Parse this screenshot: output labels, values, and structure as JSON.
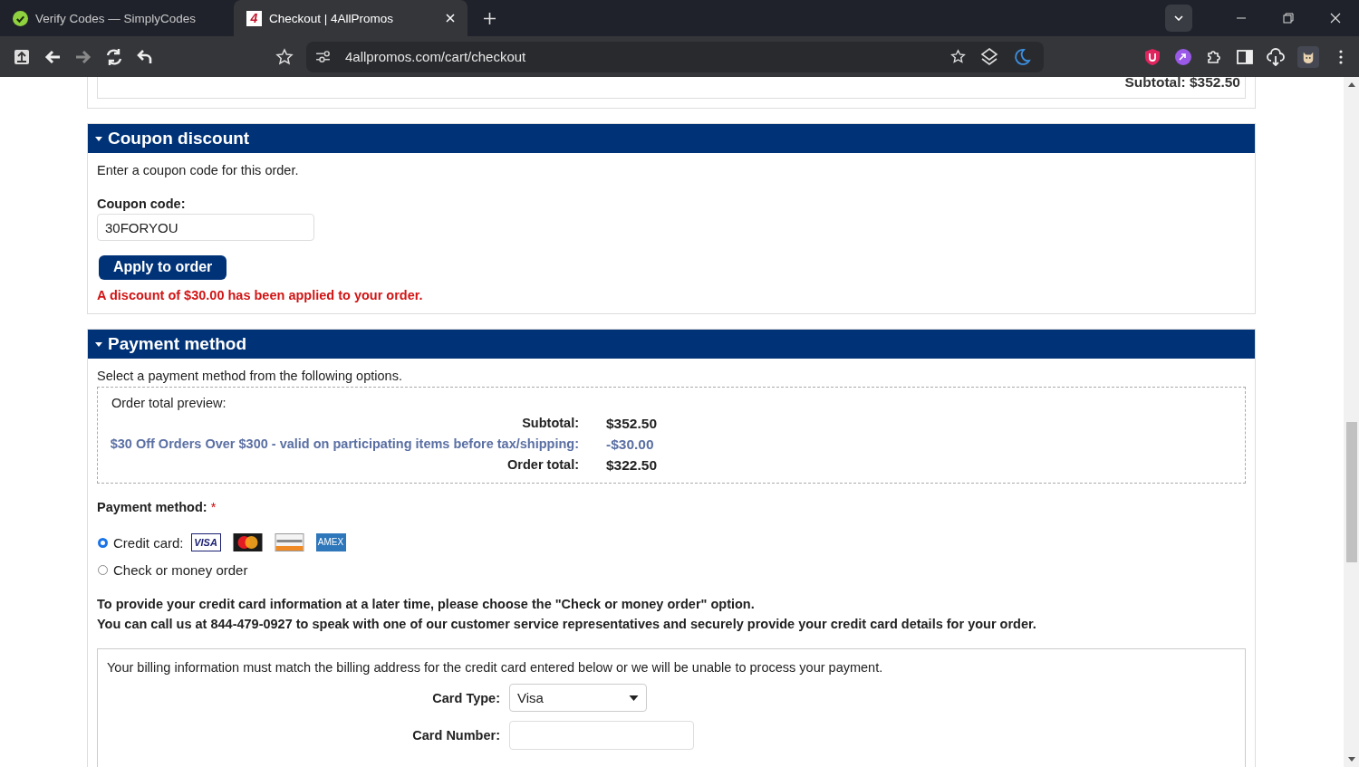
{
  "browser": {
    "tabs": [
      {
        "title": "Verify Codes — SimplyCodes",
        "selected": false
      },
      {
        "title": "Checkout | 4AllPromos",
        "selected": true,
        "logo": "4"
      }
    ],
    "url": "4allpromos.com/cart/checkout"
  },
  "cart": {
    "subtotal": "Subtotal: $352.50"
  },
  "coupon": {
    "title": "Coupon discount",
    "expanded": true,
    "intro": "Enter a coupon code for this order.",
    "label": "Coupon code:",
    "value": "30FORYOU",
    "button": "Apply to order",
    "message": "A discount of $30.00 has been applied to your order."
  },
  "payment": {
    "title": "Payment method",
    "expanded": true,
    "intro": "Select a payment method from the following options.",
    "preview": {
      "title": "Order total preview:",
      "lines": [
        {
          "kind": "total",
          "label": "Subtotal:",
          "amount": "$352.50"
        },
        {
          "kind": "discount",
          "label": "$30 Off Orders Over $300 - valid on participating items before tax/shipping:",
          "amount": "-$30.00"
        },
        {
          "kind": "total",
          "label": "Order total:",
          "amount": "$322.50"
        }
      ]
    },
    "method_label": "Payment method:",
    "required_mark": "*",
    "options": [
      {
        "label": "Credit card:",
        "selected": true,
        "logos": [
          {
            "kind": "visa",
            "label": "VISA"
          },
          {
            "kind": "mastercard"
          },
          {
            "kind": "discover"
          },
          {
            "kind": "amex",
            "label": "AMEX"
          }
        ]
      },
      {
        "label": "Check or money order",
        "selected": false
      }
    ],
    "notice": [
      "To provide your credit card information at a later time, please choose the \"Check or money order\" option.",
      "You can call us at 844-479-0927 to speak with one of our customer service representatives and securely provide your credit card details for your order."
    ],
    "billing": {
      "note": "Your billing information must match the billing address for the credit card entered below or we will be unable to process your payment.",
      "fields": [
        {
          "kind": "select",
          "label": "Card Type:",
          "value": "Visa"
        },
        {
          "kind": "input",
          "label": "Card Number:"
        }
      ]
    }
  }
}
